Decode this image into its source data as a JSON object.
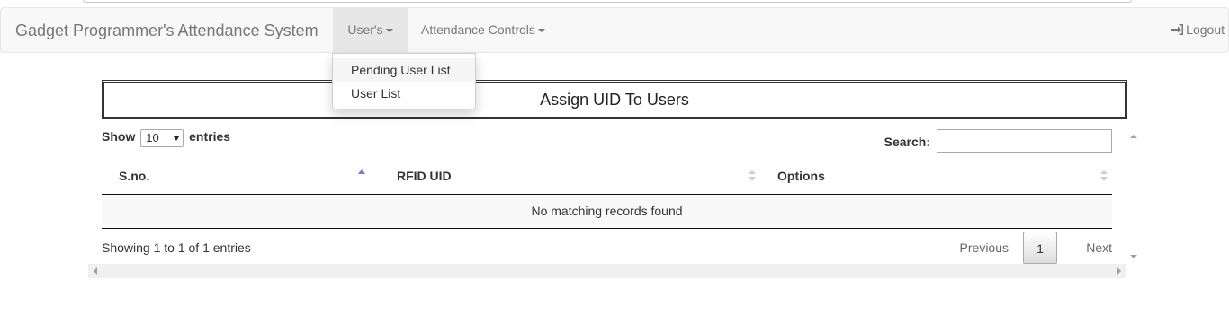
{
  "navbar": {
    "brand": "Gadget Programmer's Attendance System",
    "users_menu": "User's",
    "attendance_menu": "Attendance Controls",
    "logout": "Logout"
  },
  "users_dropdown": {
    "items": [
      {
        "label": "Pending User List"
      },
      {
        "label": "User List"
      }
    ]
  },
  "panel": {
    "title": "Assign UID To Users"
  },
  "table_controls": {
    "show_label": "Show",
    "page_length": "10",
    "entries_label": "entries",
    "search_label": "Search:",
    "search_value": ""
  },
  "table": {
    "columns": [
      "S.no.",
      "RFID UID",
      "Options"
    ],
    "empty_message": "No matching records found"
  },
  "footer": {
    "info": "Showing 1 to 1 of 1 entries",
    "previous": "Previous",
    "current_page": "1",
    "next": "Next"
  },
  "icons": {
    "logout": "log-out-icon",
    "caret": "caret-down-icon",
    "sort": "sort-icon"
  },
  "colors": {
    "navbar_bg": "#f8f8f8",
    "active_nav": "#e7e7e7",
    "sort_active": "#7a7ad0"
  }
}
